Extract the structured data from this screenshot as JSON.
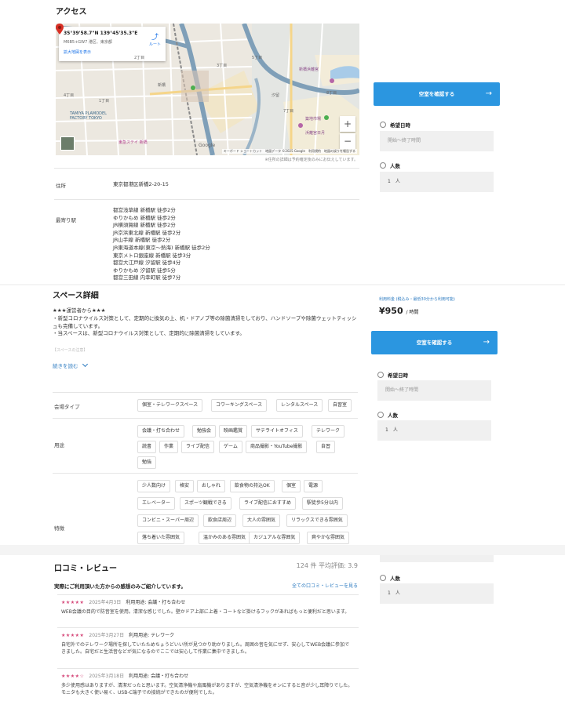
{
  "access": {
    "title": "アクセス",
    "map": {
      "coords": "35°39'58.7\"N 139°45'35.3\"E",
      "address": "M6B5+GW7 港区、東京都",
      "route": "ルート",
      "enlarge": "拡大地図を表示",
      "zoom_in": "+",
      "zoom_out": "−",
      "google": "Google",
      "footer": "キーボード ショートカット　地図データ ©2025 Google　利用規約　地図の誤りを報告する",
      "labels": [
        "新橋",
        "新橋浜離宮",
        "築地市場",
        "浜離宮日月",
        "東急ステイ 新橋",
        "TAMIYA PLAMODEL FACTORY TOKYO",
        "汐留",
        "1丁目",
        "2丁目",
        "3丁目",
        "4丁目",
        "5丁目",
        "7丁目",
        "8丁目"
      ]
    },
    "note": "※住所の詳細は予約確定後のみにお伝えしています。",
    "address_label": "住所",
    "address_value": "東京都港区新橋2-20-15",
    "station_label": "最寄り駅",
    "stations": [
      "都営浅草線 新橋駅 徒歩2分",
      "ゆりかもめ 新橋駅 徒歩2分",
      "JR横須賀線 新橋駅 徒歩2分",
      "JR京浜東北線 新橋駅 徒歩2分",
      "JR山手線 新橋駅 徒歩2分",
      "JR東海道本線(東京〜熱海) 新橋駅 徒歩2分",
      "東京メトロ銀座線 新橋駅 徒歩3分",
      "都営大江戸線 汐留駅 徒歩4分",
      "ゆりかもめ 汐留駅 徒歩5分",
      "都営三田線 内幸町駅 徒歩7分"
    ]
  },
  "booking": {
    "check_label": "空室を確認する",
    "arrow": "→",
    "date_label": "希望日時",
    "date_placeholder": "開始〜終了時間",
    "people_label": "人数",
    "people_value": "1　人",
    "price_label": "利用料金 (税込み・最低30分から利用可能)",
    "price": "¥950",
    "price_unit": "/ 時間"
  },
  "detail": {
    "title": "スペース詳細",
    "paragraphs": [
      "★★★運営者から★★★",
      "・新型コロナウイルス対策として、定期的に換気の上、机・ドアノブ等の除菌清掃をしており、ハンドソープや除菌ウェットティッシュも完備しています。",
      "・当スペースは、新型コロナウイルス対策として、定期的に除菌清掃をしています。"
    ],
    "faded": "【スペースの注意】",
    "read_more": "続きを読む",
    "venue_type_label": "会場タイプ",
    "venue_types": [
      "個室・テレワークスペース",
      "コワーキングスペース",
      "レンタルスペース",
      "自習室"
    ],
    "usage_label": "用途",
    "usages": [
      "会議・打ち合わせ",
      "勉強会",
      "映画鑑賞",
      "サテライトオフィス",
      "テレワーク",
      "読書",
      "作業",
      "ライブ配信",
      "ゲーム",
      "商品撮影・YouTube撮影",
      "自習",
      "勉強"
    ],
    "feature_label": "特徴",
    "features": [
      "少人数向け",
      "格安",
      "おしゃれ",
      "飲食物の持込OK",
      "個室",
      "電源",
      "エレベーター",
      "スポーツ観戦できる",
      "ライブ配信におすすめ",
      "駅徒歩5分以内",
      "コンビニ・スーパー周辺",
      "飲食店周辺",
      "大人の雰囲気",
      "リラックスできる雰囲気",
      "落ち着いた雰囲気",
      "温かみのある雰囲気",
      "カジュアルな雰囲気",
      "爽やかな雰囲気"
    ]
  },
  "reviews": {
    "title": "口コミ・レビュー",
    "summary": "124 件 平均評価: 3.9",
    "intro": "実際にご利用頂いた方からの感想のみご紹介しています。",
    "see_all": "全ての口コミ・レビューを見る",
    "items": [
      {
        "stars": "★★★★★",
        "date": "2025年4月3日",
        "usage": "利用用途: 会議・打ち合わせ",
        "text": "WEB会議の目的で防音室を使用。清潔な感じでした。壁かドア上部に上着・コートなど掛けるフックがあればもっと便利だと思います。",
        "rating": 5
      },
      {
        "stars": "★★★★★",
        "date": "2025年3月27日",
        "usage": "利用用途: テレワーク",
        "text": "自宅外でのテレワーク場所を探していたためちょうどいい所が見つかり助かりました。周囲の音を気にせず、安心してWEB会議に参加できました。自宅だと生活音などが気になるのでここでは安心して作業に集中できました。",
        "rating": 5
      },
      {
        "stars": "★★★★☆",
        "date": "2025年3月18日",
        "usage": "利用用途: 会議・打ち合わせ",
        "text": "多少使用感はありますが、清潔だったと思います。空気清浄機や扇風機がありますが、空気清浄機をオンにすると音が少し耳障りでした。モニタも大きく使い易く、USB-C端子での接続ができたのが便利でした。",
        "rating": 4
      }
    ]
  },
  "colors": {
    "accent": "#2b96e0",
    "stars": "#d6497a",
    "link": "#2b7ac0"
  }
}
